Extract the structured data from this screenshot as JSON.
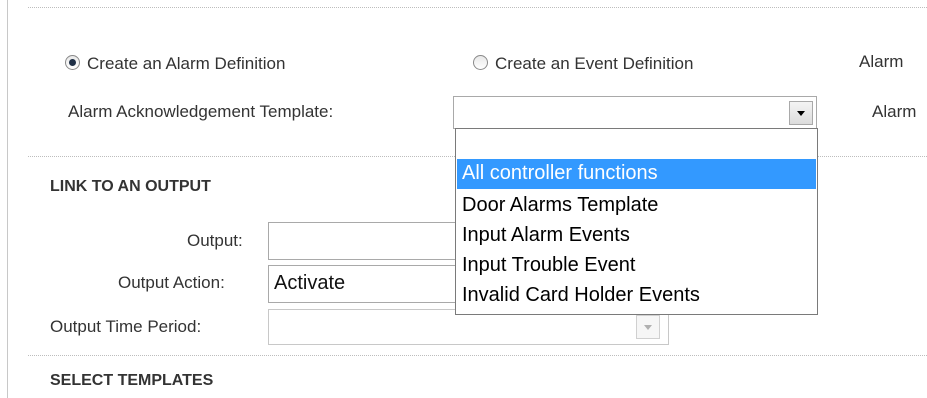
{
  "definition_type": {
    "alarm_option_label": "Create an Alarm Definition",
    "event_option_label": "Create an Event Definition",
    "alarm_selected": true,
    "right_clipped_label_1": "Alarm",
    "right_clipped_label_2": "Alarm"
  },
  "ack_template": {
    "label": "Alarm Acknowledgement Template:",
    "value": "",
    "options": [
      "",
      "All controller functions",
      "Door Alarms Template",
      "Input Alarm Events",
      "Input Trouble Event",
      "Invalid Card Holder Events"
    ],
    "highlighted_option": "All controller functions"
  },
  "link_output": {
    "heading": "LINK TO AN OUTPUT",
    "output_label": "Output:",
    "output_value": "",
    "action_label": "Output Action:",
    "action_value": "Activate",
    "time_period_label": "Output Time Period:",
    "time_period_value": ""
  },
  "select_templates": {
    "heading": "SELECT TEMPLATES"
  },
  "colors": {
    "highlight": "#3399ff",
    "divider": "#bdbdbd"
  }
}
